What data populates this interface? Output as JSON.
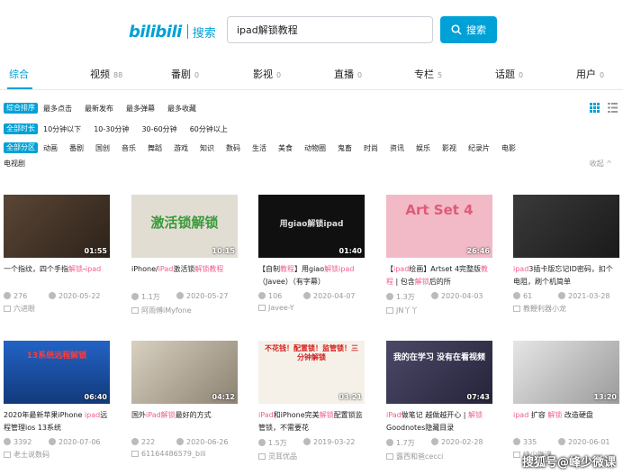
{
  "header": {
    "logo": "bilibili",
    "logo_suffix": "搜索",
    "search_value": "ipad解锁教程",
    "search_button": "搜索"
  },
  "tabs": [
    {
      "label": "综合",
      "count": ""
    },
    {
      "label": "视频",
      "count": "88"
    },
    {
      "label": "番剧",
      "count": "0"
    },
    {
      "label": "影视",
      "count": "0"
    },
    {
      "label": "直播",
      "count": "0"
    },
    {
      "label": "专栏",
      "count": "5"
    },
    {
      "label": "话题",
      "count": "0"
    },
    {
      "label": "用户",
      "count": "0"
    }
  ],
  "filters": {
    "sort_label": "综合排序",
    "sort_items": [
      "最多点击",
      "最新发布",
      "最多弹幕",
      "最多收藏"
    ],
    "duration_label": "全部时长",
    "duration_items": [
      "10分钟以下",
      "10-30分钟",
      "30-60分钟",
      "60分钟以上"
    ],
    "zone_label": "全部分区",
    "zone_items": [
      "动画",
      "番剧",
      "国创",
      "音乐",
      "舞蹈",
      "游戏",
      "知识",
      "数码",
      "生活",
      "美食",
      "动物圈",
      "鬼畜",
      "时尚",
      "资讯",
      "娱乐",
      "影视",
      "纪录片",
      "电影"
    ],
    "zone_items_row2": [
      "电视剧"
    ],
    "collapse": "收起 ^"
  },
  "videos": [
    {
      "dur": "01:55",
      "t1": "一个指纹，四个手指",
      "hl1": "解锁",
      "t2": "-",
      "t3": "",
      "hl2": "ipad",
      "t4": "",
      "views": "276",
      "date": "2020-05-22",
      "author": "六进眼",
      "bg": "#4a3a2e",
      "thumb_text": ""
    },
    {
      "dur": "10:15",
      "t1": "iPhone/",
      "hl1": "iPad",
      "t2": "激活锁",
      "t3": "",
      "hl2": "解锁",
      "t4": "",
      "hl3": "教程",
      "views": "1.1万",
      "date": "2020-05-27",
      "author": "阿雨傅iMyfone",
      "bg": "#dcd8d0",
      "thumb_text": "激活锁解锁"
    },
    {
      "dur": "01:40",
      "t1": "【自制",
      "hl1": "教程",
      "t2": "】用giao",
      "t3": "",
      "hl2": "解锁",
      "t4": "",
      "hl3": "ipad",
      "t5": "（Javee）（有字幕）",
      "views": "106",
      "date": "2020-04-07",
      "author": "Javee-Y",
      "bg": "#111111",
      "thumb_text": "用giao解锁ipad"
    },
    {
      "dur": "26:46",
      "t1": "【",
      "hl1": "ipad",
      "t2": "绘画】Artset 4完整版",
      "t3": "",
      "hl2": "教程",
      "t4": " | 包含",
      "hl3": "解锁",
      "t5": "后的所",
      "views": "1.3万",
      "date": "2020-04-03",
      "author": "JN丫丫",
      "bg": "#f1b9c4",
      "thumb_text": "Art Set 4"
    },
    {
      "dur": "",
      "t1": "",
      "hl1": "ipad",
      "t2": "3插卡版忘记ID密码，扣个电阻，刷个机简单",
      "t3": "",
      "hl2": "",
      "t4": "",
      "views": "61",
      "date": "2021-03-28",
      "author": "教鞭利器小龙",
      "bg": "#2b2b2b",
      "thumb_text": ""
    },
    {
      "dur": "06:40",
      "t1": "2020年最新苹果iPhone ",
      "hl1": "ipad",
      "t2": "远程管理ios 13系统",
      "t3": "",
      "hl2": "",
      "t4": "",
      "views": "3392",
      "date": "2020-07-06",
      "author": "老土说数码",
      "bg": "#1e56b0",
      "thumb_text": "13系统远程解锁"
    },
    {
      "dur": "04:12",
      "t1": "国外",
      "hl1": "iPad",
      "t2": "",
      "t3": "",
      "hl2": "解锁",
      "t4": "最好的方式",
      "views": "222",
      "date": "2020-06-26",
      "author": "61164486579_bili",
      "bg": "#c9c2b5",
      "thumb_text": ""
    },
    {
      "dur": "03:21",
      "t1": "",
      "hl1": "iPad",
      "t2": "和iPhone完美",
      "t3": "",
      "hl2": "解锁",
      "t4": "配置锁监管锁，不需要花",
      "views": "1.5万",
      "date": "2019-03-22",
      "author": "灵耳优品",
      "bg": "#f7f2ea",
      "thumb_text": "不花钱！配置锁！监管锁！三分钟解锁"
    },
    {
      "dur": "07:43",
      "t1": "",
      "hl1": "iPad",
      "t2": "做笔记 越做越开心 | ",
      "t3": "",
      "hl2": "解锁",
      "t4": "Goodnotes隐藏目录",
      "views": "1.7万",
      "date": "2020-02-28",
      "author": "露西和爸cecci",
      "bg": "#3c3a55",
      "thumb_text": "我的在学习 没有在看视频"
    },
    {
      "dur": "13:20",
      "t1": "",
      "hl1": "ipad",
      "t2": " 扩容 ",
      "t3": "",
      "hl2": "解锁",
      "t4": " 改造硬盘",
      "views": "335",
      "date": "2020-06-01",
      "author": "峰少微课",
      "bg": "#d4d4d4",
      "thumb_text": ""
    }
  ],
  "watermark": "搜狐号@峰少微课"
}
